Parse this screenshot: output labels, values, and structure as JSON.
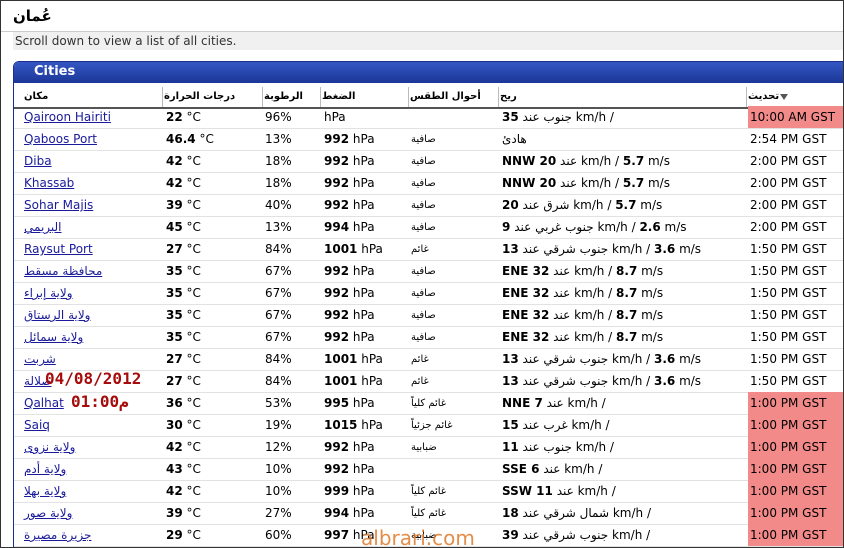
{
  "header": {
    "title": "عُمان",
    "subtitle": "Scroll down to view a list of all cities."
  },
  "panel": {
    "title": "Cities",
    "columns": {
      "city": "مكان",
      "temperature": "درجات الحرارة",
      "humidity": "الرطوبة",
      "pressure": "الضغط",
      "weather": "أحوال الطقس",
      "wind": "ريح",
      "updated": "تحديث"
    }
  },
  "colors": {
    "highlight": "#f38a8a",
    "panel_head": "#1f3fa6",
    "link": "#1a1a9a"
  },
  "rows": [
    {
      "city": "Qairoon Hairiti",
      "temp": "22",
      "temp_unit": "°C",
      "hum": "96%",
      "pres": "",
      "pres_unit": "hPa",
      "wx": "",
      "wind_a": "35",
      "wind_b": " جنوب عند km/h /",
      "upd": "10:00 AM GST",
      "hl": true
    },
    {
      "city": "Qaboos Port",
      "temp": "46.4",
      "temp_unit": "°C",
      "hum": "13%",
      "pres": "992",
      "pres_unit": "hPa",
      "wx": "صافية",
      "wind_a": "",
      "wind_b": "هادئ",
      "upd": "2:54 PM GST",
      "hl": false
    },
    {
      "city": "Diba",
      "temp": "42",
      "temp_unit": "°C",
      "hum": "18%",
      "pres": "992",
      "pres_unit": "hPa",
      "wx": "صافية",
      "wind_a": "NNW 20",
      "wind_b": " عند km/h / ",
      "wind_c": "5.7",
      "wind_d": " m/s",
      "upd": "2:00 PM GST",
      "hl": false
    },
    {
      "city": "Khassab",
      "temp": "42",
      "temp_unit": "°C",
      "hum": "18%",
      "pres": "992",
      "pres_unit": "hPa",
      "wx": "صافية",
      "wind_a": "NNW 20",
      "wind_b": " عند km/h / ",
      "wind_c": "5.7",
      "wind_d": " m/s",
      "upd": "2:00 PM GST",
      "hl": false
    },
    {
      "city": "Sohar Majis",
      "temp": "39",
      "temp_unit": "°C",
      "hum": "40%",
      "pres": "992",
      "pres_unit": "hPa",
      "wx": "صافية",
      "wind_a": "20",
      "wind_b": " شرق عند km/h / ",
      "wind_c": "5.7",
      "wind_d": " m/s",
      "upd": "2:00 PM GST",
      "hl": false
    },
    {
      "city": "البريمي",
      "temp": "45",
      "temp_unit": "°C",
      "hum": "13%",
      "pres": "994",
      "pres_unit": "hPa",
      "wx": "صافية",
      "wind_a": "9",
      "wind_b": " جنوب غربي عند km/h / ",
      "wind_c": "2.6",
      "wind_d": " m/s",
      "upd": "2:00 PM GST",
      "hl": false
    },
    {
      "city": "Raysut Port",
      "temp": "27",
      "temp_unit": "°C",
      "hum": "84%",
      "pres": "1001",
      "pres_unit": "hPa",
      "wx": "غائم",
      "wind_a": "13",
      "wind_b": " جنوب شرقي عند km/h / ",
      "wind_c": "3.6",
      "wind_d": " m/s",
      "upd": "1:50 PM GST",
      "hl": false
    },
    {
      "city": "محافظة مسقط",
      "temp": "35",
      "temp_unit": "°C",
      "hum": "67%",
      "pres": "992",
      "pres_unit": "hPa",
      "wx": "صافية",
      "wind_a": "ENE 32",
      "wind_b": " عند km/h / ",
      "wind_c": "8.7",
      "wind_d": " m/s",
      "upd": "1:50 PM GST",
      "hl": false
    },
    {
      "city": "ولاية إبراء",
      "temp": "35",
      "temp_unit": "°C",
      "hum": "67%",
      "pres": "992",
      "pres_unit": "hPa",
      "wx": "صافية",
      "wind_a": "ENE 32",
      "wind_b": " عند km/h / ",
      "wind_c": "8.7",
      "wind_d": " m/s",
      "upd": "1:50 PM GST",
      "hl": false
    },
    {
      "city": "ولاية الرستاق",
      "temp": "35",
      "temp_unit": "°C",
      "hum": "67%",
      "pres": "992",
      "pres_unit": "hPa",
      "wx": "صافية",
      "wind_a": "ENE 32",
      "wind_b": " عند km/h / ",
      "wind_c": "8.7",
      "wind_d": " m/s",
      "upd": "1:50 PM GST",
      "hl": false
    },
    {
      "city": "ولاية سمائل",
      "temp": "35",
      "temp_unit": "°C",
      "hum": "67%",
      "pres": "992",
      "pres_unit": "hPa",
      "wx": "صافية",
      "wind_a": "ENE 32",
      "wind_b": " عند km/h / ",
      "wind_c": "8.7",
      "wind_d": " m/s",
      "upd": "1:50 PM GST",
      "hl": false
    },
    {
      "city": "شربت",
      "temp": "27",
      "temp_unit": "°C",
      "hum": "84%",
      "pres": "1001",
      "pres_unit": "hPa",
      "wx": "غائم",
      "wind_a": "13",
      "wind_b": " جنوب شرقي عند km/h / ",
      "wind_c": "3.6",
      "wind_d": " m/s",
      "upd": "1:50 PM GST",
      "hl": false
    },
    {
      "city": "صلالة",
      "temp": "27",
      "temp_unit": "°C",
      "hum": "84%",
      "pres": "1001",
      "pres_unit": "hPa",
      "wx": "غائم",
      "wind_a": "13",
      "wind_b": " جنوب شرقي عند km/h / ",
      "wind_c": "3.6",
      "wind_d": " m/s",
      "upd": "1:50 PM GST",
      "hl": false
    },
    {
      "city": "Qalhat",
      "temp": "36",
      "temp_unit": "°C",
      "hum": "53%",
      "pres": "995",
      "pres_unit": "hPa",
      "wx": "غائم كلياً",
      "wind_a": "NNE 7",
      "wind_b": " عند km/h /",
      "upd": "1:00 PM GST",
      "hl": true
    },
    {
      "city": "Saiq",
      "temp": "30",
      "temp_unit": "°C",
      "hum": "19%",
      "pres": "1015",
      "pres_unit": "hPa",
      "wx": "غائم جزئياً",
      "wind_a": "15",
      "wind_b": " غرب عند km/h /",
      "upd": "1:00 PM GST",
      "hl": true
    },
    {
      "city": "ولاية نزوى",
      "temp": "42",
      "temp_unit": "°C",
      "hum": "12%",
      "pres": "992",
      "pres_unit": "hPa",
      "wx": "ضبابية",
      "wind_a": "11",
      "wind_b": " جنوب عند km/h /",
      "upd": "1:00 PM GST",
      "hl": true
    },
    {
      "city": "ولاية أدم",
      "temp": "43",
      "temp_unit": "°C",
      "hum": "10%",
      "pres": "992",
      "pres_unit": "hPa",
      "wx": "",
      "wind_a": "SSE 6",
      "wind_b": " عند km/h /",
      "upd": "1:00 PM GST",
      "hl": true
    },
    {
      "city": "ولاية بهلا",
      "temp": "42",
      "temp_unit": "°C",
      "hum": "10%",
      "pres": "999",
      "pres_unit": "hPa",
      "wx": "غائم كلياً",
      "wind_a": "SSW 11",
      "wind_b": " عند km/h /",
      "upd": "1:00 PM GST",
      "hl": true
    },
    {
      "city": "ولاية صور",
      "temp": "39",
      "temp_unit": "°C",
      "hum": "27%",
      "pres": "994",
      "pres_unit": "hPa",
      "wx": "غائم كلياً",
      "wind_a": "18",
      "wind_b": " شمال شرقي عند km/h /",
      "upd": "1:00 PM GST",
      "hl": true
    },
    {
      "city": "جزيرة مصيرة",
      "temp": "29",
      "temp_unit": "°C",
      "hum": "60%",
      "pres": "997",
      "pres_unit": "hPa",
      "wx": "ضبابية",
      "wind_a": "39",
      "wind_b": " جنوب شرقي عند km/h /",
      "upd": "1:00 PM GST",
      "hl": true
    }
  ],
  "overlay": {
    "date": "04/08/2012",
    "time": "01:00م"
  },
  "watermark": "albrari.com"
}
